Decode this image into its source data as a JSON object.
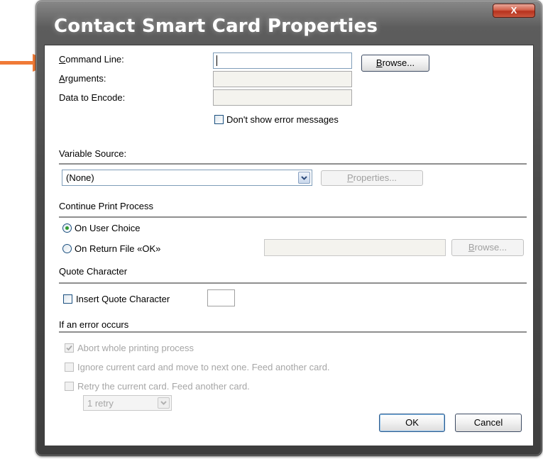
{
  "window": {
    "title": "Contact Smart Card Properties",
    "close_glyph": "X"
  },
  "annotation": {
    "arrow_color": "#f07a36",
    "icon": "arrow-right-icon"
  },
  "fields": {
    "command_line_label": "Command Line:",
    "arguments_label": "Arguments:",
    "data_to_encode_label": "Data to Encode:",
    "command_line_value": "",
    "arguments_value": "",
    "data_to_encode_value": "",
    "browse_label": "Browse...",
    "dont_show_errors_label": "Don't show error messages"
  },
  "variable_source": {
    "heading": "Variable Source:",
    "selected": "(None)",
    "properties_label": "Properties..."
  },
  "continue_print": {
    "heading": "Continue Print Process",
    "on_user_choice": "On User Choice",
    "on_return_file": "On Return File «OK»",
    "browse_label": "Browse...",
    "selected": "On User Choice"
  },
  "quote": {
    "heading": "Quote Character",
    "insert_label": "Insert Quote Character",
    "value": ""
  },
  "error": {
    "heading": "If an error occurs",
    "abort_label": "Abort whole printing process",
    "ignore_label": "Ignore current card and move to next one. Feed another card.",
    "retry_label": "Retry the current card. Feed another card.",
    "retry_count": "1 retry"
  },
  "buttons": {
    "ok": "OK",
    "cancel": "Cancel"
  }
}
